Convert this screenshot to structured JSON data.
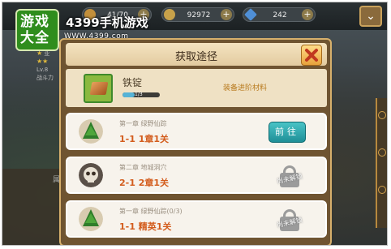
{
  "watermark": {
    "logo_chars": "游戏大全",
    "brand": "4399手机游戏",
    "url": "WWW.4399.com"
  },
  "topbar": {
    "stamina": "41/70",
    "gold": "92972",
    "diamond": "242"
  },
  "side": {
    "name_char": "亚",
    "level": "Lv.8",
    "power_label": "战斗力",
    "panel_char": "属"
  },
  "dialog": {
    "title": "获取途径",
    "item": {
      "name": "铁锭",
      "count": "1/3",
      "progress": 0.33,
      "description": "装备进阶材料"
    },
    "sources": [
      {
        "chapter": "第一章  绿野仙踪",
        "stage": "1-1  1章1关",
        "action": "前往",
        "locked": false,
        "thumb": "tree"
      },
      {
        "chapter": "第二章  地城洞穴",
        "stage": "2-1  2章1关",
        "action": "尚未解锁",
        "locked": true,
        "thumb": "skull"
      },
      {
        "chapter": "第一章  绿野仙踪(0/3)",
        "stage": "1-1  精英1关",
        "action": "尚未解锁",
        "locked": true,
        "thumb": "tree"
      }
    ]
  },
  "colors": {
    "dialog_border": "#d7b06c",
    "go_button": "#2aa6ad",
    "stage_text": "#d35c1c"
  }
}
